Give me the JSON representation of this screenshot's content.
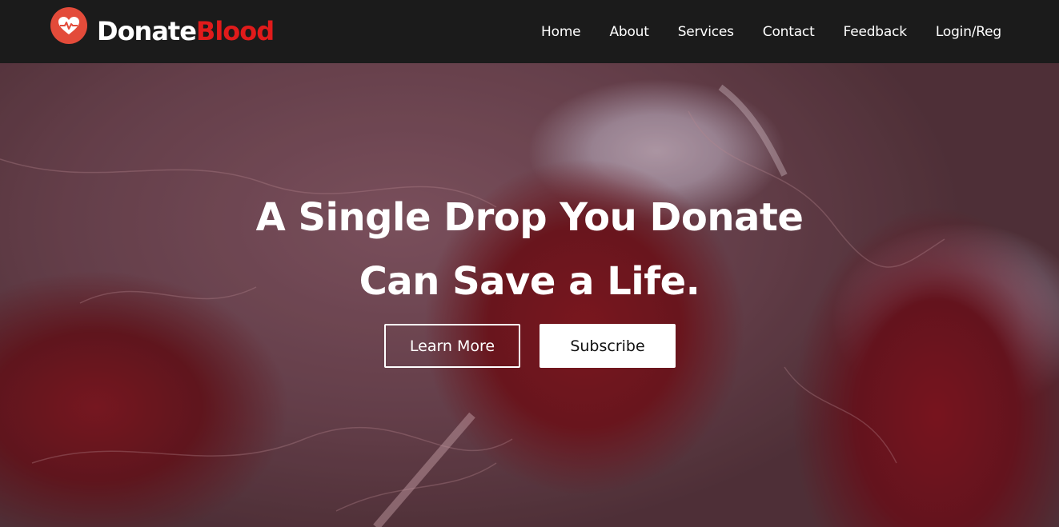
{
  "brand": {
    "logo_icon": "heart-pulse-icon",
    "name_part1": "Donate",
    "name_part2": "Blood",
    "accent_color": "#e01b1b"
  },
  "nav": {
    "items": [
      "Home",
      "About",
      "Services",
      "Contact",
      "Feedback",
      "Login/Reg"
    ]
  },
  "hero": {
    "title_line1": "A Single Drop You Donate",
    "title_line2": "Can Save a Life.",
    "learn_more_label": "Learn More",
    "subscribe_label": "Subscribe"
  }
}
